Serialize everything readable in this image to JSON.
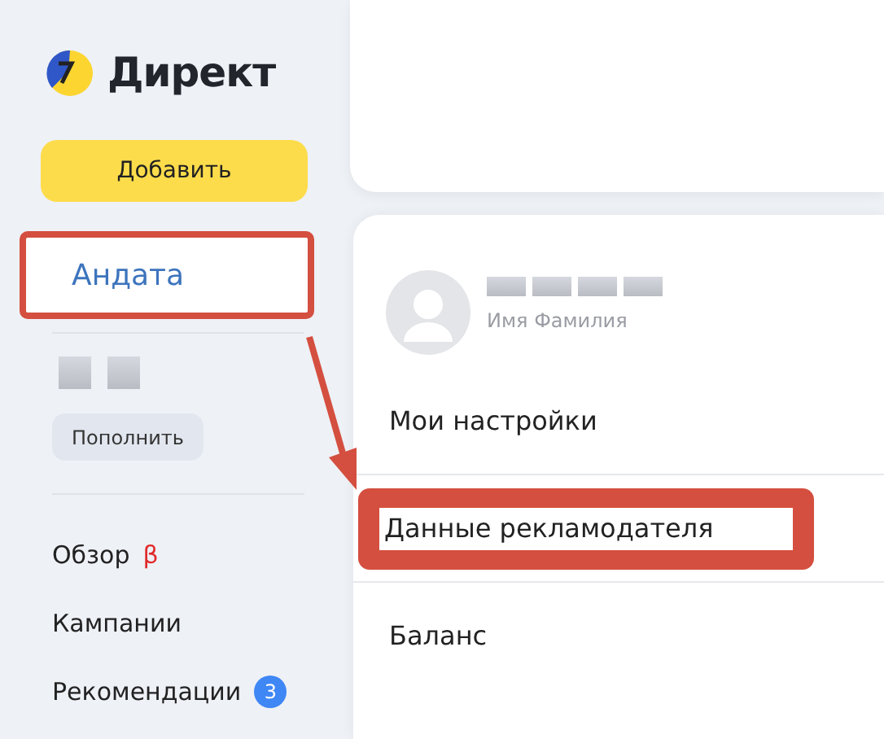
{
  "logo": {
    "text": "Директ"
  },
  "add_button": "Добавить",
  "account": {
    "name": "Андата",
    "highlighted": true
  },
  "top_up_button": "Пополнить",
  "nav": [
    {
      "label": "Обзор",
      "kind": "beta",
      "badge": "β"
    },
    {
      "label": "Кампании",
      "kind": "plain"
    },
    {
      "label": "Рекомендации",
      "kind": "count",
      "badge": "3"
    }
  ],
  "user_menu": {
    "user_caption": "Имя Фамилия",
    "items": [
      {
        "label": "Мои настройки",
        "highlighted": false
      },
      {
        "label": "Данные рекламодателя",
        "highlighted": true
      },
      {
        "label": "Баланс",
        "highlighted": false
      }
    ]
  }
}
